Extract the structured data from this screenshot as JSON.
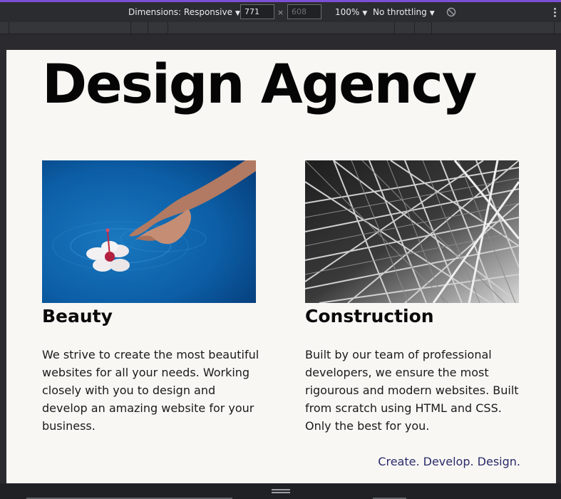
{
  "devtools": {
    "dimensions_label": "Dimensions: Responsive",
    "width_value": "771",
    "height_placeholder": "608",
    "times": "×",
    "zoom": "100%",
    "throttling": "No throttling",
    "dropdown_arrow": "▼"
  },
  "page": {
    "title": "Design Agency",
    "cards": [
      {
        "heading": "Beauty",
        "body": "We strive to create the most beautiful websites for all your needs. Working closely with you to design and develop an amazing website for your business."
      },
      {
        "heading": "Construction",
        "body": "Built by our team of professional developers, we ensure the most rigourous and modern websites. Built from scratch using HTML and CSS. Only the best for you."
      }
    ],
    "tagline": "Create. Develop. Design."
  },
  "colors": {
    "accent": "#7b4fd6",
    "page_bg": "#f8f7f4",
    "tagline": "#2a2a6a"
  }
}
